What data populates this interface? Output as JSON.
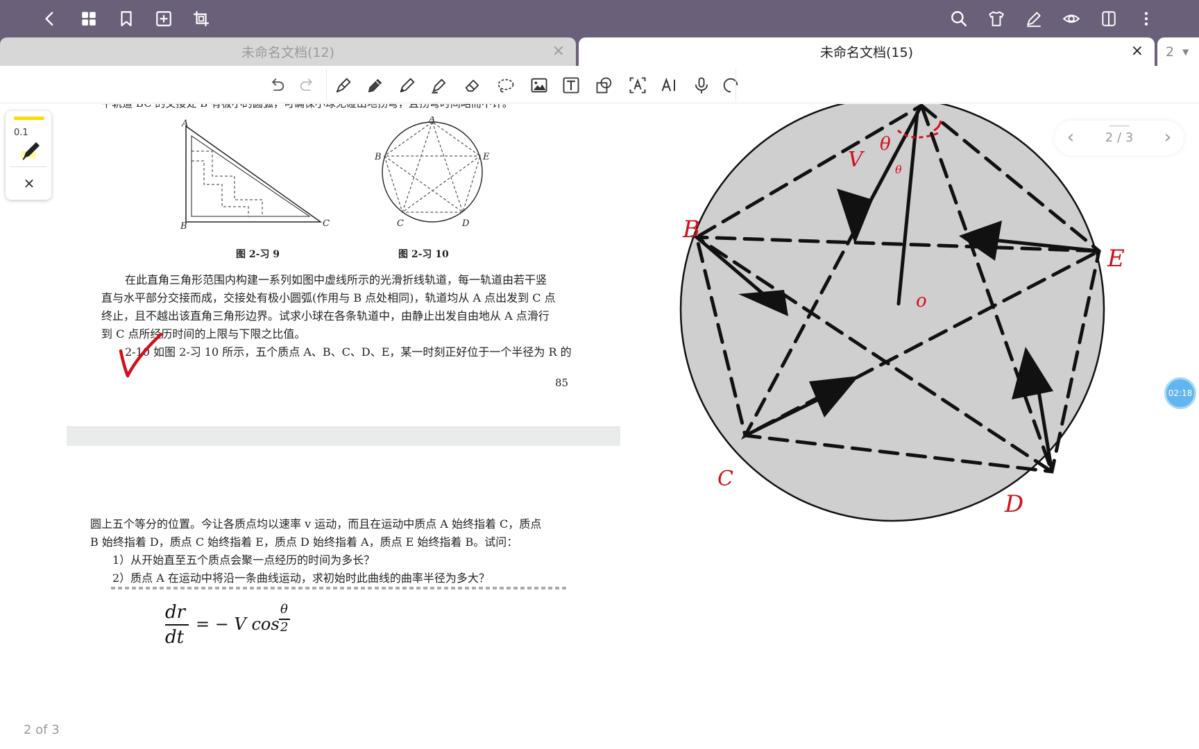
{
  "tabs": [
    {
      "label": "未命名文档(12)",
      "close": "×"
    },
    {
      "label": "未命名文档(15)",
      "close": "×"
    }
  ],
  "tab_count": "2",
  "tab_count_caret": "▼",
  "pen_palette": {
    "size": "0.1",
    "color": "#f5e100",
    "close": "×"
  },
  "book": {
    "line_top": "平轨道 BC 的交接处 B 有极小的圆弧，可确保小球无碰出地拐弯，且拐弯时间略而不计。",
    "fig_caption_9": "图 2-习 9",
    "fig_caption_10": "图 2-习 10",
    "para1": [
      "在此直角三角形范围内构建一系列如图中虚线所示的光滑折线轨道，每一轨道由若干竖",
      "直与水平部分交接而成，交接处有极小圆弧(作用与 B 点处相同)，轨道均从 A 点出发到 C 点",
      "终止，且不越出该直角三角形边界。试求小球在各条轨道中，由静止出发自由地从 A 点滑行",
      "到 C 点所经历时间的上限与下限之比值。"
    ],
    "problem_start": "2-10 如图 2-习 10 所示，五个质点 A、B、C、D、E，某一时刻正好位于一个半径为 R 的",
    "page_number": "85",
    "para2": [
      "圆上五个等分的位置。今让各质点均以速率 v 运动，而且在运动中质点 A 始终指着 C，质点",
      "B 始终指着 D，质点 C 始终指着 E，质点 D 始终指着 A，质点 E 始终指着 B。试问：",
      "1）从开始直至五个质点会聚一点经历的时间为多长？",
      "2）质点 A 在运动中将沿一条曲线运动，求初始时此曲线的曲率半径为多大？"
    ],
    "fig9_labels": [
      "A",
      "B",
      "C"
    ],
    "fig10_labels": [
      "A",
      "B",
      "C",
      "D",
      "E"
    ]
  },
  "handwriting": {
    "equation_lhs_num": "dr",
    "equation_lhs_den": "dt",
    "equation_rhs": "= − V cos",
    "theta_num": "θ",
    "theta_den": "2"
  },
  "drawing": {
    "labels": [
      "B",
      "E",
      "C",
      "D",
      "V",
      "θ",
      "o"
    ],
    "ink_red": "#d0101a",
    "fill_gray": "#cfcfcf"
  },
  "page_indicator": {
    "text": "2 / 3",
    "prev": "‹",
    "next": "›"
  },
  "timer": "02:18",
  "page_of": "2 of 3"
}
